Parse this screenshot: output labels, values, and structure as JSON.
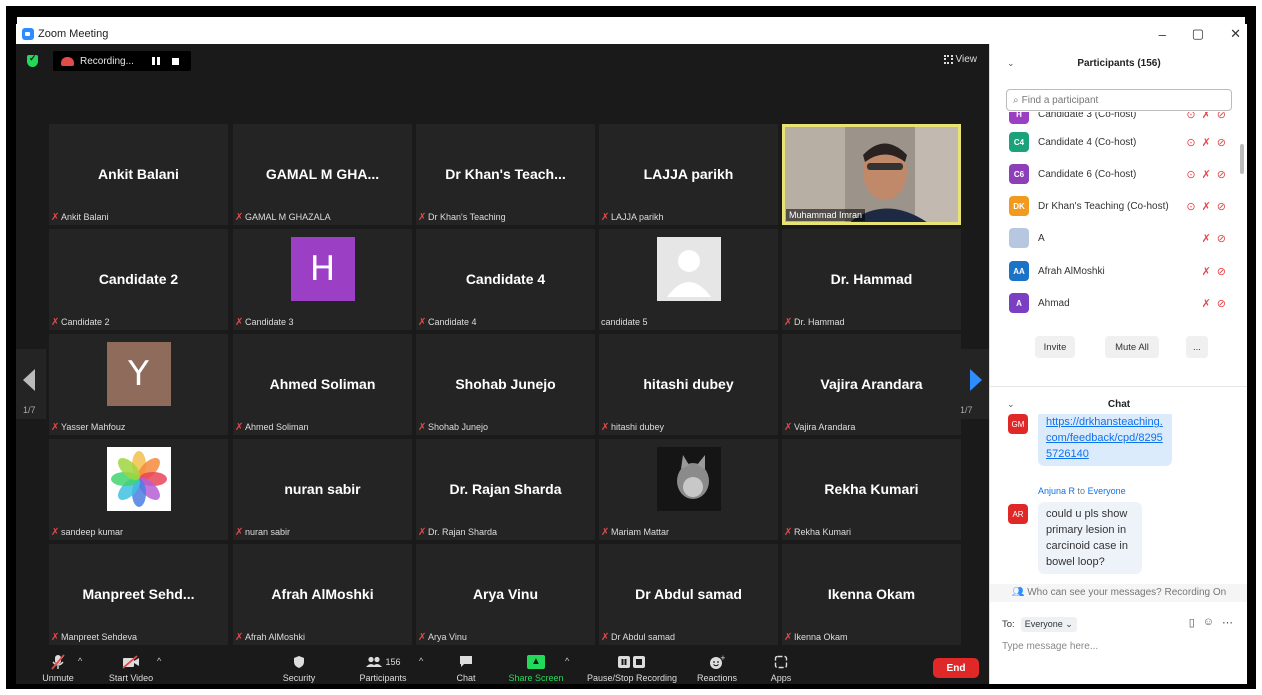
{
  "window": {
    "title": "Zoom Meeting",
    "minimize": "–",
    "maximize": "▢",
    "close": "✕"
  },
  "topbar": {
    "recording_label": "Recording...",
    "view_label": "View"
  },
  "tiles": [
    {
      "name": "Ankit Balani",
      "label": "Ankit Balani",
      "muted": true
    },
    {
      "name": "GAMAL M GHA...",
      "label": "GAMAL M GHAZALA",
      "muted": true
    },
    {
      "name": "Dr Khan's Teach...",
      "label": "Dr Khan's Teaching",
      "muted": true
    },
    {
      "name": "LAJJA parikh",
      "label": "LAJJA parikh",
      "muted": true
    },
    {
      "name": "",
      "label": "Muhammad Imran",
      "muted": false
    },
    {
      "name": "Candidate 2",
      "label": "Candidate 2",
      "muted": true
    },
    {
      "name": "",
      "label": "Candidate 3",
      "muted": true,
      "avatar": "H"
    },
    {
      "name": "Candidate 4",
      "label": "Candidate 4",
      "muted": true
    },
    {
      "name": "",
      "label": "candidate 5",
      "muted": false
    },
    {
      "name": "Dr. Hammad",
      "label": "Dr. Hammad",
      "muted": true
    },
    {
      "name": "",
      "label": "Yasser Mahfouz",
      "muted": true,
      "avatar": "Y"
    },
    {
      "name": "Ahmed Soliman",
      "label": "Ahmed Soliman",
      "muted": true
    },
    {
      "name": "Shohab Junejo",
      "label": "Shohab Junejo",
      "muted": true
    },
    {
      "name": "hitashi dubey",
      "label": "hitashi dubey",
      "muted": true
    },
    {
      "name": "Vajira Arandara",
      "label": "Vajira Arandara",
      "muted": true
    },
    {
      "name": "",
      "label": "sandeep kumar",
      "muted": true
    },
    {
      "name": "nuran sabir",
      "label": "nuran sabir",
      "muted": true
    },
    {
      "name": "Dr. Rajan Sharda",
      "label": "Dr. Rajan Sharda",
      "muted": true
    },
    {
      "name": "",
      "label": "Mariam Mattar",
      "muted": true
    },
    {
      "name": "Rekha Kumari",
      "label": "Rekha Kumari",
      "muted": true
    },
    {
      "name": "Manpreet Sehd...",
      "label": "Manpreet Sehdeva",
      "muted": true
    },
    {
      "name": "Afrah AlMoshki",
      "label": "Afrah AlMoshki",
      "muted": true
    },
    {
      "name": "Arya Vinu",
      "label": "Arya Vinu",
      "muted": true
    },
    {
      "name": "Dr Abdul samad",
      "label": "Dr Abdul samad",
      "muted": true
    },
    {
      "name": "Ikenna Okam",
      "label": "Ikenna Okam",
      "muted": true
    }
  ],
  "pagination": {
    "left": "1/7",
    "right": "1/7"
  },
  "toolbar": {
    "unmute": "Unmute",
    "start_video": "Start Video",
    "security": "Security",
    "participants": "Participants",
    "participants_count": "156",
    "chat": "Chat",
    "share_screen": "Share Screen",
    "pause_recording": "Pause/Stop Recording",
    "reactions": "Reactions",
    "apps": "Apps",
    "end": "End"
  },
  "participants_panel": {
    "title": "Participants (156)",
    "search_placeholder": "Find a participant",
    "list": [
      {
        "initials": "H",
        "name": "Candidate 3 (Co-host)",
        "color": "#9b3fc4"
      },
      {
        "initials": "C4",
        "name": "Candidate 4 (Co-host)",
        "color": "#1aa37a"
      },
      {
        "initials": "C6",
        "name": "Candidate 6 (Co-host)",
        "color": "#8c3fb8"
      },
      {
        "initials": "DK",
        "name": "Dr Khan's Teaching (Co-host)",
        "color": "#f29a1e"
      },
      {
        "initials": "",
        "name": "A",
        "color": "#b8c7e0"
      },
      {
        "initials": "AA",
        "name": "Afrah AlMoshki",
        "color": "#1a73c9"
      },
      {
        "initials": "A",
        "name": "Ahmad",
        "color": "#7b3fc4"
      }
    ],
    "invite": "Invite",
    "mute_all": "Mute All",
    "more": "..."
  },
  "chat_panel": {
    "title": "Chat",
    "msg1_avatar": "GM",
    "msg1_text": "https://drkhansteaching.com/feedback/cpd/82955726140",
    "msg2_sender": "Anjuna R",
    "msg2_to": "to",
    "msg2_recipient": "Everyone",
    "msg2_avatar": "AR",
    "msg2_text": "could u pls show primary lesion in carcinoid case in bowel loop?",
    "who_can_see": "Who can see your messages? Recording On",
    "to_label": "To:",
    "to_value": "Everyone",
    "input_placeholder": "Type message here..."
  },
  "colors": {
    "accent": "#2d8cff",
    "green": "#23d959",
    "red": "#e02828",
    "active_border": "#e8e473"
  }
}
